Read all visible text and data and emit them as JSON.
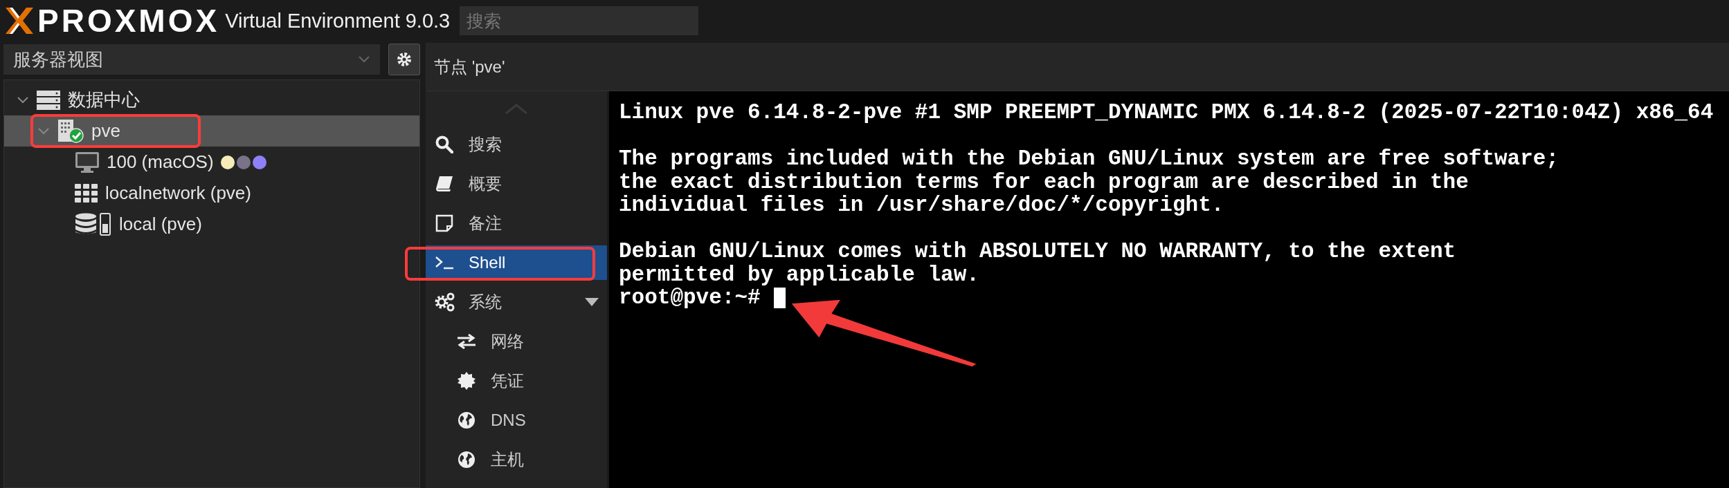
{
  "header": {
    "logo": "PROXMOX",
    "product": "Virtual Environment 9.0.3",
    "search": {
      "placeholder": "搜索"
    }
  },
  "view_selector": {
    "value": "服务器视图"
  },
  "tree": [
    {
      "kind": "datacenter",
      "label": "数据中心",
      "expanded": true,
      "selected": false,
      "annotated": false,
      "children": [
        {
          "kind": "node",
          "label": "pve",
          "online": true,
          "expanded": true,
          "selected": true,
          "annotated": true,
          "children": [
            {
              "kind": "vm",
              "label": "100 (macOS)",
              "selected": false,
              "annotated": false,
              "tags": [
                {
                  "color": "#f5ecb9"
                },
                {
                  "color": "#7a7388"
                },
                {
                  "color": "#8e80f6"
                }
              ]
            },
            {
              "kind": "network",
              "label": "localnetwork (pve)",
              "selected": false,
              "annotated": false
            },
            {
              "kind": "storage",
              "label": "local (pve)",
              "selected": false,
              "annotated": false
            }
          ]
        }
      ]
    }
  ],
  "panel_title": "节点 'pve'",
  "nav": [
    {
      "kind": "search",
      "label": "搜索",
      "selected": false,
      "annotated": false
    },
    {
      "kind": "summary",
      "label": "概要",
      "selected": false,
      "annotated": false
    },
    {
      "kind": "notes",
      "label": "备注",
      "selected": false,
      "annotated": false
    },
    {
      "kind": "shell",
      "label": "Shell",
      "selected": true,
      "annotated": true
    },
    {
      "kind": "system",
      "label": "系统",
      "selected": false,
      "annotated": false,
      "expanded": true,
      "children": [
        {
          "kind": "network",
          "label": "网络",
          "selected": false,
          "annotated": false
        },
        {
          "kind": "certificate",
          "label": "凭证",
          "selected": false,
          "annotated": false
        },
        {
          "kind": "dns",
          "label": "DNS",
          "selected": false,
          "annotated": false
        },
        {
          "kind": "hosts",
          "label": "主机",
          "selected": false,
          "annotated": false
        }
      ]
    }
  ],
  "terminal": {
    "paragraphs": [
      [
        "Linux pve 6.14.8-2-pve #1 SMP PREEMPT_DYNAMIC PMX 6.14.8-2 (2025-07-22T10:04Z) x86_64"
      ],
      [
        "The programs included with the Debian GNU/Linux system are free software;",
        "the exact distribution terms for each program are described in the",
        "individual files in /usr/share/doc/*/copyright."
      ],
      [
        "Debian GNU/Linux comes with ABSOLUTELY NO WARRANTY, to the extent",
        "permitted by applicable law."
      ]
    ],
    "prompt": "root@pve:~#",
    "cursor": true,
    "pointer_arrow": true
  }
}
